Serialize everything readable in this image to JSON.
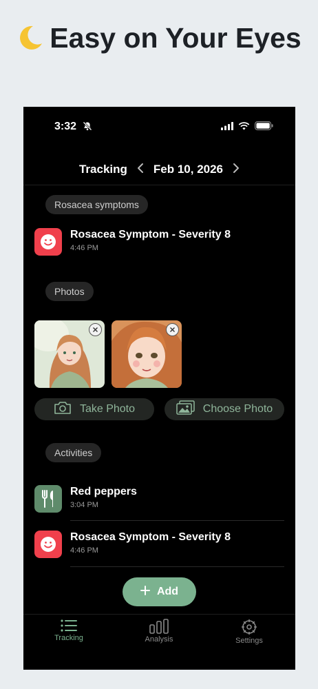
{
  "headline": {
    "emoji": "🌙",
    "text": "Easy on Your Eyes"
  },
  "status_bar": {
    "time": "3:32"
  },
  "nav": {
    "title": "Tracking",
    "date": "Feb 10, 2026"
  },
  "sections": {
    "symptoms": "Rosacea symptoms",
    "photos": "Photos",
    "activities": "Activities"
  },
  "symptom_entry": {
    "title": "Rosacea Symptom - Severity 8",
    "time": "4:46 PM"
  },
  "photo_actions": {
    "take": "Take Photo",
    "choose": "Choose Photo"
  },
  "activities": [
    {
      "title": "Red peppers",
      "time": "3:04 PM",
      "icon": "fork-knife-icon"
    },
    {
      "title": "Rosacea Symptom - Severity 8",
      "time": "4:46 PM",
      "icon": "smiley-face-icon"
    }
  ],
  "add_button": "Add",
  "tabs": [
    "Tracking",
    "Analysis",
    "Settings"
  ],
  "colors": {
    "accent": "#7bb28f",
    "symptom_red": "#f0404c",
    "food_green": "#5f8b6b",
    "background": "#000000"
  }
}
